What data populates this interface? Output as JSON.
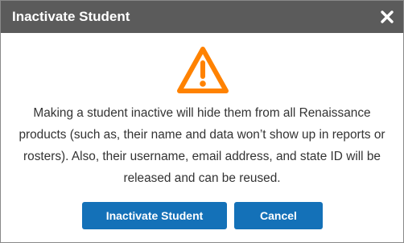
{
  "dialog": {
    "title": "Inactivate Student",
    "close_icon": "close-x-icon",
    "warning_icon": "warning-triangle-icon",
    "message": "Making a student inactive will hide them from all Renaissance products (such as, their name and data won’t show up in reports or rosters). Also, their username, email address, and state ID will be released and can be reused.",
    "buttons": {
      "inactivate_label": "Inactivate Student",
      "cancel_label": "Cancel"
    },
    "colors": {
      "title_bar": "#5b5b5b",
      "warning": "#ff8200",
      "button": "#1471b8",
      "text": "#333333"
    }
  }
}
